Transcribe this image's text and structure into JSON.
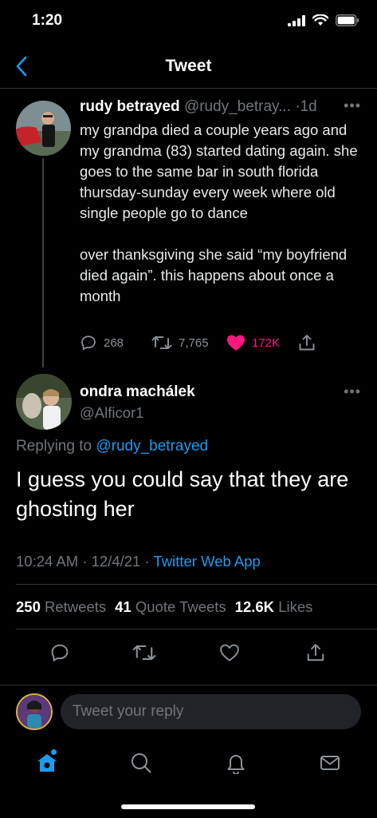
{
  "status_bar": {
    "time": "1:20"
  },
  "nav": {
    "title": "Tweet"
  },
  "original_tweet": {
    "author_name": "rudy betrayed",
    "author_handle": "@rudy_betray...",
    "separator": "·",
    "age": "1d",
    "paragraphs": [
      "my grandpa died a couple years ago and my grandma (83) started dating again. she goes to the same bar in south florida thursday-sunday every week where old single people go to dance",
      "over thanksgiving she said “my boyfriend died again”. this happens about once a month"
    ],
    "reply_count": "268",
    "retweet_count": "7,765",
    "like_count": "172K"
  },
  "reply_tweet": {
    "author_name": "ondra machálek",
    "author_handle": "@Alficor1",
    "replying_to_prefix": "Replying to",
    "replying_to_handle": "@rudy_betrayed",
    "text": "I guess you could say that they are ghosting her",
    "time": "10:24 AM",
    "date": "12/4/21",
    "separator": "·",
    "source": "Twitter Web App",
    "retweets_count": "250",
    "retweets_label": "Retweets",
    "quote_count": "41",
    "quote_label": "Quote Tweets",
    "likes_count": "12.6K",
    "likes_label": "Likes"
  },
  "composer": {
    "placeholder": "Tweet your reply"
  },
  "tab_bar": {
    "items": [
      {
        "icon": "home-icon",
        "active": true
      },
      {
        "icon": "search-icon",
        "active": false
      },
      {
        "icon": "bell-icon",
        "active": false
      },
      {
        "icon": "mail-icon",
        "active": false
      }
    ]
  },
  "colors": {
    "background": "#000000",
    "accent": "#1d9bf0",
    "like": "#f91880",
    "muted": "#71767b",
    "divider": "#2f3336"
  }
}
